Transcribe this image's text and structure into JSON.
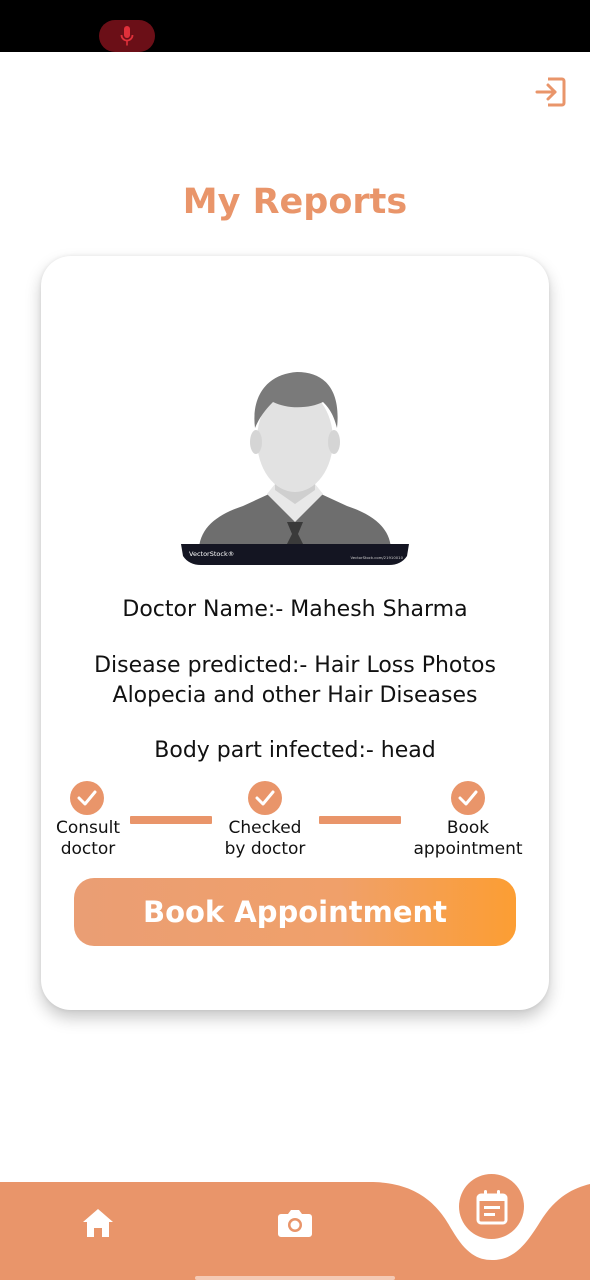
{
  "status_bar": {
    "mic_icon": "microphone-icon"
  },
  "header": {
    "logout_icon": "logout-icon",
    "title": "My Reports"
  },
  "report": {
    "avatar_icon": "doctor-avatar-image",
    "avatar_watermark_left": "VectorStock®",
    "avatar_watermark_right": "VectorStock.com/21910010",
    "doctor_name": "Doctor Name:- Mahesh Sharma",
    "disease_line1": "Disease predicted:- Hair Loss Photos",
    "disease_line2": "Alopecia and other Hair Diseases",
    "body_part": "Body part infected:- head",
    "steps": [
      {
        "line1": "Consult",
        "line2": "doctor",
        "done": true
      },
      {
        "line1": "Checked",
        "line2": "by doctor",
        "done": true
      },
      {
        "line1": "Book",
        "line2": "appointment",
        "done": true
      }
    ],
    "book_button": "Book Appointment"
  },
  "bottom_nav": {
    "items": [
      {
        "icon": "home-icon"
      },
      {
        "icon": "camera-icon"
      },
      {
        "icon": "reports-icon",
        "active": true
      }
    ]
  },
  "colors": {
    "accent": "#e9956a",
    "button_gradient_end": "#fc9e33",
    "status_bar": "#000000"
  }
}
